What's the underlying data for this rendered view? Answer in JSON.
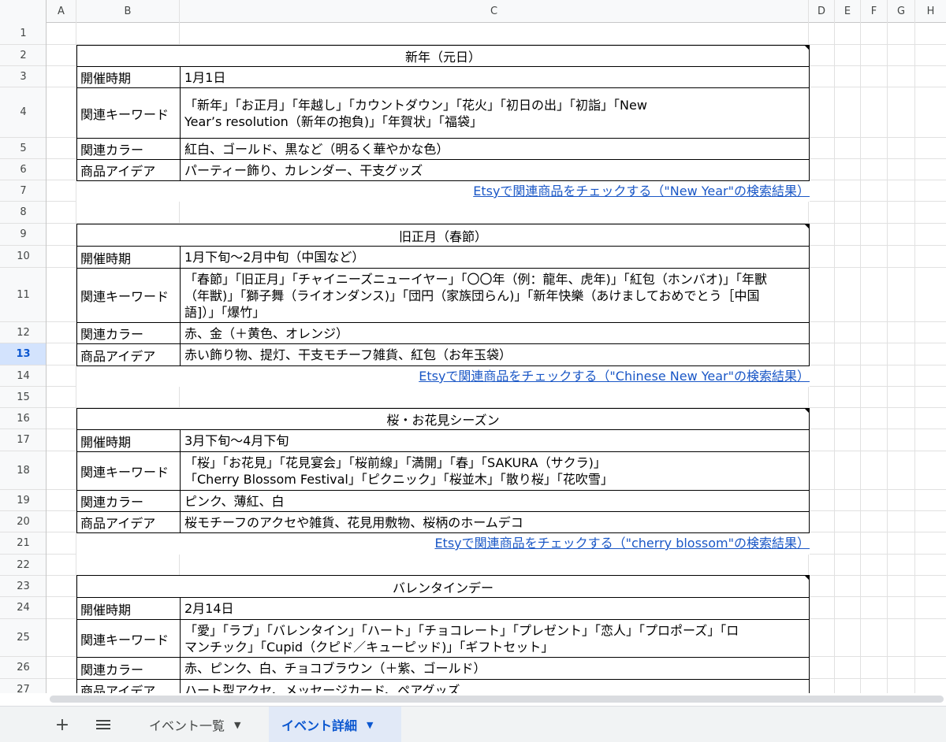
{
  "columns": [
    "A",
    "B",
    "C",
    "D",
    "E",
    "F",
    "G",
    "H"
  ],
  "rows": [
    "1",
    "2",
    "3",
    "4",
    "5",
    "6",
    "7",
    "8",
    "9",
    "10",
    "11",
    "12",
    "13",
    "14",
    "15",
    "16",
    "17",
    "18",
    "19",
    "20",
    "21",
    "22",
    "23",
    "24",
    "25",
    "26",
    "27"
  ],
  "active_row": "13",
  "events": [
    {
      "title": "新年（元日）",
      "fields": [
        {
          "label": "開催時期",
          "value": "1月1日"
        },
        {
          "label": "関連キーワード",
          "value": "「新年」「お正月」「年越し」「カウントダウン」「花火」「初日の出」「初詣」「New Year’s resolution（新年の抱負)」「年賀状」「福袋」"
        },
        {
          "label": "関連カラー",
          "value": "紅白、ゴールド、黒など（明るく華やかな色）"
        },
        {
          "label": "商品アイデア",
          "value": "パーティー飾り、カレンダー、干支グッズ"
        }
      ],
      "link": "Etsyで関連商品をチェックする（\"New Year\"の検索結果）"
    },
    {
      "title": "旧正月（春節）",
      "fields": [
        {
          "label": "開催時期",
          "value": "1月下旬〜2月中旬（中国など）"
        },
        {
          "label": "関連キーワード",
          "value": "「春節」「旧正月」「チャイニーズニューイヤー」「〇〇年（例：龍年、虎年)」「紅包（ホンバオ)」「年獸（年獣)」「獅子舞（ライオンダンス)」「団円（家族団らん)」「新年快樂（あけましておめでとう［中国語]）」「爆竹」"
        },
        {
          "label": "関連カラー",
          "value": "赤、金（＋黄色、オレンジ）"
        },
        {
          "label": "商品アイデア",
          "value": "赤い飾り物、提灯、干支モチーフ雑貨、紅包（お年玉袋）"
        }
      ],
      "link": "Etsyで関連商品をチェックする（\"Chinese New Year\"の検索結果）"
    },
    {
      "title": "桜・お花見シーズン",
      "fields": [
        {
          "label": "開催時期",
          "value": "3月下旬〜4月下旬"
        },
        {
          "label": "関連キーワード",
          "value": "「桜」「お花見」「花見宴会」「桜前線」「満開」「春」「SAKURA（サクラ)」「Cherry Blossom Festival」「ピクニック」「桜並木」「散り桜」「花吹雪」"
        },
        {
          "label": "関連カラー",
          "value": "ピンク、薄紅、白"
        },
        {
          "label": "商品アイデア",
          "value": "桜モチーフのアクセや雑貨、花見用敷物、桜柄のホームデコ"
        }
      ],
      "link": "Etsyで関連商品をチェックする（\"cherry blossom\"の検索結果）"
    },
    {
      "title": "バレンタインデー",
      "fields": [
        {
          "label": "開催時期",
          "value": "2月14日"
        },
        {
          "label": "関連キーワード",
          "value": "「愛」「ラブ」「バレンタイン」「ハート」「チョコレート」「プレゼント」「恋人」「プロポーズ」「ロマンチック」「Cupid（クピド／キューピッド)」「ギフトセット」"
        },
        {
          "label": "関連カラー",
          "value": "赤、ピンク、白、チョコブラウン（＋紫、ゴールド）"
        },
        {
          "label": "商品アイデア",
          "value": "ハート型アクセ、メッセージカード、ペアグッズ"
        }
      ]
    }
  ],
  "sheet_tabs": {
    "add_icon": "plus-icon",
    "menu_icon": "list-icon",
    "tabs": [
      "イベント一覧",
      "イベント詳細"
    ],
    "active": "イベント詳細"
  }
}
